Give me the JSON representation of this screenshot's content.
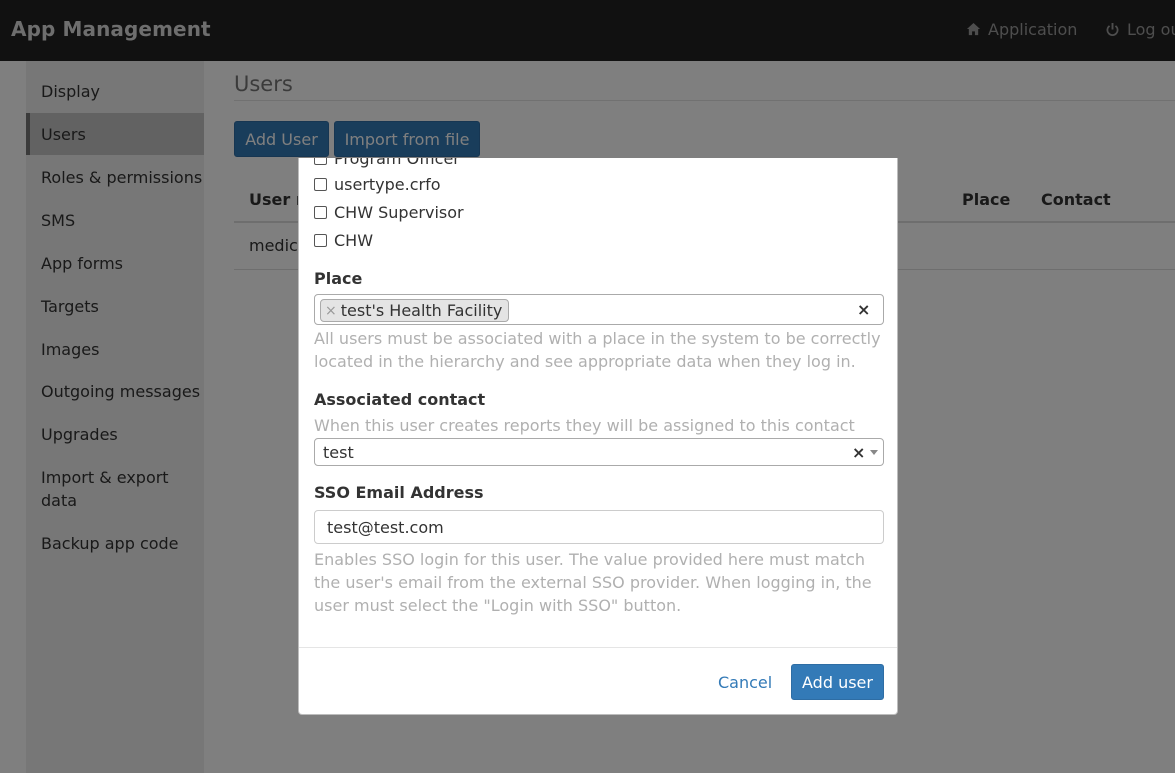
{
  "navbar": {
    "brand": "App Management",
    "application": "Application",
    "logout": "Log ou"
  },
  "sidebar": {
    "items": [
      {
        "label": "Display"
      },
      {
        "label": "Users",
        "active": true
      },
      {
        "label": "Roles & permissions"
      },
      {
        "label": "SMS"
      },
      {
        "label": "App forms"
      },
      {
        "label": "Targets"
      },
      {
        "label": "Images"
      },
      {
        "label": "Outgoing messages"
      },
      {
        "label": "Upgrades"
      },
      {
        "label": "Import & export data"
      },
      {
        "label": "Backup app code"
      }
    ]
  },
  "main": {
    "title": "Users",
    "add_user_btn": "Add User",
    "import_btn": "Import from file",
    "table": {
      "headers": [
        "User n",
        "Place",
        "Contact"
      ],
      "rows": [
        [
          "medic",
          "",
          ""
        ]
      ]
    }
  },
  "modal": {
    "roles": [
      "Program Officer",
      "usertype.crfo",
      "CHW Supervisor",
      "CHW"
    ],
    "place_label": "Place",
    "place_tag": "test's Health Facility",
    "place_help": "All users must be associated with a place in the system to be correctly located in the hierarchy and see appropriate data when they log in.",
    "contact_label": "Associated contact",
    "contact_help": "When this user creates reports they will be assigned to this contact",
    "contact_value": "test",
    "sso_label": "SSO Email Address",
    "sso_value": "test@test.com",
    "sso_help": "Enables SSO login for this user. The value provided here must match the user's email from the external SSO provider. When logging in, the user must select the \"Login with SSO\" button.",
    "cancel": "Cancel",
    "submit": "Add user",
    "clear_glyph": "×"
  },
  "colors": {
    "navbar": "#222222",
    "primary": "#337ab7",
    "sidebar": "#eeeeee",
    "sidebar_active": "#c4c4c4"
  }
}
